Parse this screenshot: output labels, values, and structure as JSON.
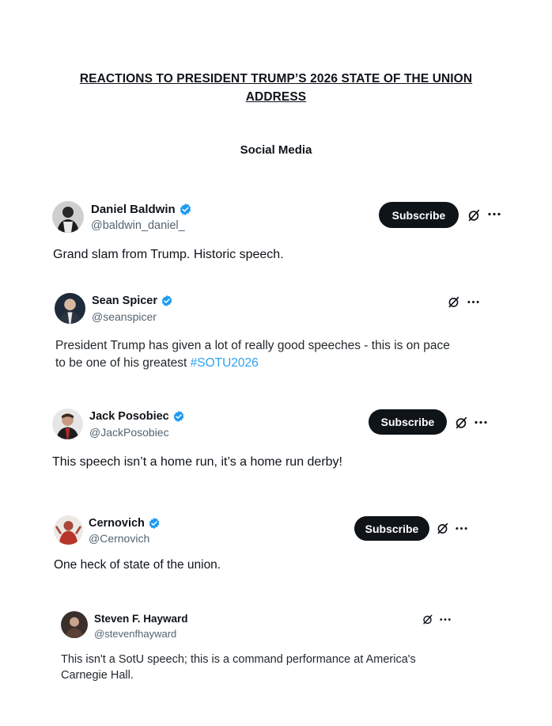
{
  "document": {
    "title_line1": "REACTIONS TO PRESIDENT TRUMP’S 2026 STATE OF THE UNION",
    "title_line2": "ADDRESS",
    "section_heading": "Social Media"
  },
  "posts": [
    {
      "name": "Daniel Baldwin",
      "handle": "@baldwin_daniel_",
      "subscribe_label": "Subscribe",
      "text": "Grand slam from Trump. Historic speech.",
      "verified_icon": "verified-badge-icon",
      "avatar_icon": "avatar-photo"
    },
    {
      "name": "Sean Spicer",
      "handle": "@seanspicer",
      "text_line1": "President Trump has given a lot of really good speeches - this is on pace",
      "text_line2_prefix": "to be one of his greatest ",
      "hashtag": "#SOTU2026",
      "verified_icon": "verified-badge-icon",
      "avatar_icon": "avatar-photo"
    },
    {
      "name": "Jack Posobiec",
      "handle": "@JackPosobiec",
      "subscribe_label": "Subscribe",
      "text": "This speech isn’t a home run, it’s a home run derby!",
      "verified_icon": "verified-badge-icon",
      "extra_icon": "crescent-flag-icon",
      "avatar_icon": "avatar-photo"
    },
    {
      "name": "Cernovich",
      "handle": "@Cernovich",
      "subscribe_label": "Subscribe",
      "text": "One heck of state of the union.",
      "verified_icon": "verified-badge-icon",
      "avatar_icon": "avatar-photo"
    },
    {
      "name": "Steven F. Hayward",
      "handle": "@stevenfhayward",
      "text_line1": "This isn't a SotU speech; this is a command performance at America's",
      "text_line2": "Carnegie Hall.",
      "avatar_icon": "avatar-photo"
    }
  ],
  "colors": {
    "text": "#0f1419",
    "handle": "#536471",
    "verified": "#1d9bf0",
    "hashtag": "#1d9bf0",
    "subscribe_bg": "#0f1419",
    "subscribe_text": "#ffffff"
  }
}
